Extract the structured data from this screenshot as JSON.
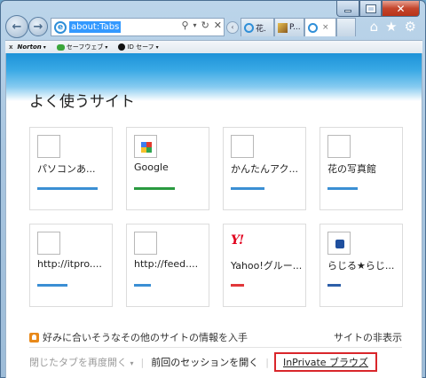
{
  "browser": {
    "address_value": "about:Tabs",
    "tabs": [
      {
        "label": "花."
      },
      {
        "label": "P..."
      },
      {
        "label": ""
      }
    ],
    "tab_close": "×"
  },
  "toolbar": {
    "close": "x",
    "norton": "Norton",
    "safeweb": "セーフウェブ",
    "idsafe": "ID セーフ"
  },
  "page": {
    "title": "よく使うサイト",
    "tiles": [
      {
        "label": "パソコンあ...",
        "bar_color": "#3b8fd4",
        "bar_fraction": 0.9,
        "icon": "blank"
      },
      {
        "label": "Google",
        "bar_color": "#2a9a40",
        "bar_fraction": 0.6,
        "icon": "google"
      },
      {
        "label": "かんたんアク...",
        "bar_color": "#3b8fd4",
        "bar_fraction": 0.5,
        "icon": "blank"
      },
      {
        "label": "花の写真館",
        "bar_color": "#3b8fd4",
        "bar_fraction": 0.45,
        "icon": "blank"
      },
      {
        "label": "http://itpro....",
        "bar_color": "#3b8fd4",
        "bar_fraction": 0.45,
        "icon": "blank"
      },
      {
        "label": "http://feed....",
        "bar_color": "#3b8fd4",
        "bar_fraction": 0.25,
        "icon": "blank"
      },
      {
        "label": "Yahoo!グルー...",
        "bar_color": "#e1373a",
        "bar_fraction": 0.2,
        "icon": "yahoo"
      },
      {
        "label": "らじる★らじ...",
        "bar_color": "#2d5fa8",
        "bar_fraction": 0.2,
        "icon": "radio"
      }
    ],
    "suggest_text": "好みに合いそうなその他のサイトの情報を入手",
    "hide_sites": "サイトの非表示",
    "reopen_closed": "閉じたタブを再度開く",
    "reopen_arrow": "▾",
    "reopen_session": "前回のセッションを開く",
    "inprivate": "InPrivate ブラウズ"
  },
  "colors": {
    "accent": "#1d92d8",
    "highlight_border": "#d9262b"
  }
}
